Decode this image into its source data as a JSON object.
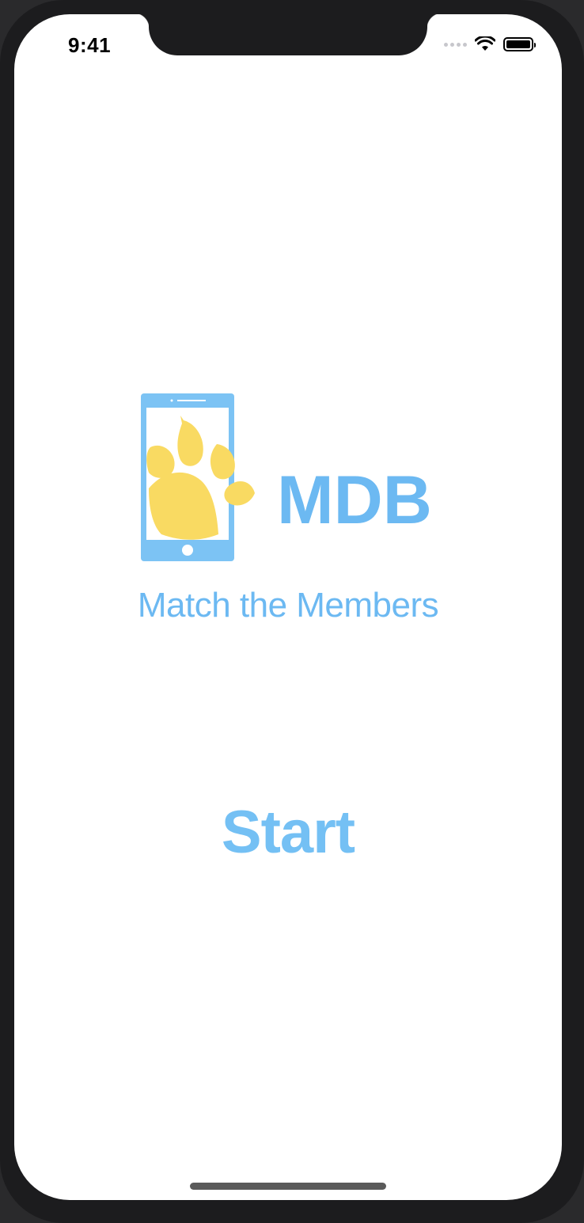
{
  "status_bar": {
    "time": "9:41",
    "icons": [
      "cellular-signal-icon",
      "wifi-icon",
      "battery-icon"
    ]
  },
  "logo": {
    "wordmark": "MDB",
    "icon": "paw-on-phone-icon",
    "colors": {
      "phone": "#7cc3f4",
      "paw": "#f9da62",
      "wordmark": "#6cb9f2"
    }
  },
  "subtitle": "Match the Members",
  "start_button": {
    "label": "Start"
  },
  "colors": {
    "accent": "#74c0f4",
    "background": "#ffffff"
  }
}
